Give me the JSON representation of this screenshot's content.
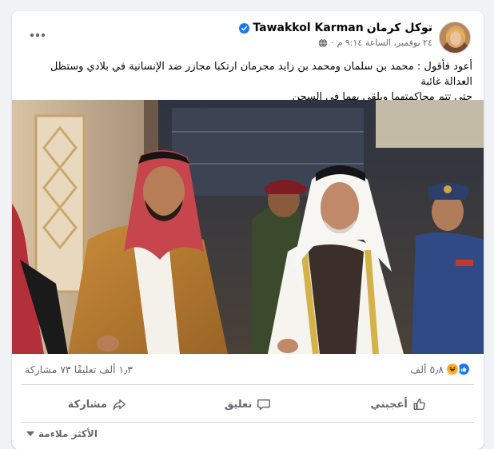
{
  "post": {
    "author": {
      "name_ar": "توكل كرمان",
      "name_en": "Tawakkol Karman",
      "verified": true
    },
    "meta": {
      "timestamp": "٢٤ نوفمبر، الساعة ٩:١٤ م",
      "separator": "·",
      "privacy_icon": "globe-icon"
    },
    "text_line1": "أعود فأقول : محمد بن سلمان ومحمد بن زايد مجرمان ارتكبا مجازر ضد الإنسانية في بلادي وستظل العدالة غائبة",
    "text_line2": "حتى تتم محاكمتهما ويلقى بهما في السجن",
    "reactions": {
      "count": "٥٫٨ ألف",
      "icons": [
        "like-icon",
        "haha-icon"
      ]
    },
    "comments": "١٫٣ ألف تعليقًا",
    "shares": "٧٣ مشاركة"
  },
  "actions": {
    "like_label": "أعجبني",
    "comment_label": "تعليق",
    "share_label": "مشاركة"
  },
  "comments_sort": {
    "label": "الأكثر ملاءمة"
  },
  "colors": {
    "facebook_blue": "#1877f2",
    "text_primary": "#050505",
    "text_secondary": "#65676b",
    "haha_yellow": "#f7b125"
  }
}
